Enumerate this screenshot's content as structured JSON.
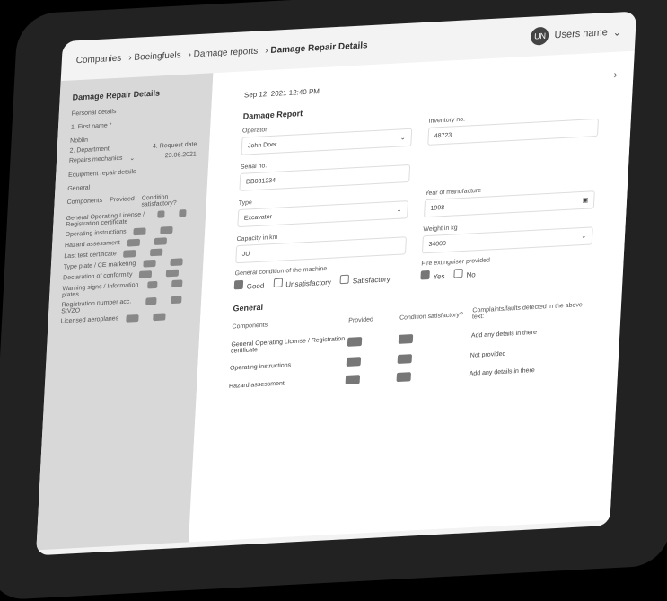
{
  "breadcrumbs": [
    "Companies",
    "Boeingfuels",
    "Damage reports",
    "Damage Repair Details"
  ],
  "user": {
    "initials": "UN",
    "name": "Users name"
  },
  "left": {
    "title": "Damage Repair Details",
    "personal": "Personal details",
    "first_name": "1. First name *",
    "first_name_value": "Noblin",
    "department": "2. Department",
    "request_date": "4. Request date",
    "department_value": "Repairs mechanics",
    "date_value": "23.06.2021",
    "equipment": "Equipment repair details",
    "general": "General",
    "table_head": [
      "Components",
      "Provided",
      "Condition satisfactory?"
    ],
    "rows": [
      "General Operating License / Registration certificate",
      "Operating instructions",
      "Hazard assessment",
      "Last test certificate",
      "Type plate / CE marketing",
      "Declaration of conformity",
      "Warning signs / Information plates",
      "Registration number acc. StVZO",
      "Licensed aeroplanes"
    ]
  },
  "right": {
    "date": "Sep 12, 2021 12:40 PM",
    "section": "Damage Report",
    "operator_label": "Operator",
    "operator_value": "John Doer",
    "inventory_label": "Inventory no.",
    "inventory_value": "48723",
    "serial_label": "Serial no.",
    "serial_value": "DB031234",
    "type_label": "Type",
    "type_value": "Excavator",
    "year_label": "Year of manufacture",
    "year_value": "1998",
    "capacity_label": "Capacity in km",
    "capacity_value": "JU",
    "weight_label": "Weight in kg",
    "weight_value": "34000",
    "condition_label": "General condition of the machine",
    "condition_options": [
      "Good",
      "Unsatisfactory",
      "Satisfactory"
    ],
    "fire_label": "Fire extinguiser provided",
    "fire_options": [
      "Yes",
      "No"
    ],
    "general": "General",
    "table_head": [
      "Components",
      "Provided",
      "Condition satisfactory?",
      "Complaints/faults detected in the above text:"
    ],
    "rows": [
      {
        "name": "General Operating License / Registration certificate",
        "note": "Add any details in there"
      },
      {
        "name": "Operating instructions",
        "note": "Not provided"
      },
      {
        "name": "Hazard assessment",
        "note": "Add any details in there"
      }
    ]
  }
}
